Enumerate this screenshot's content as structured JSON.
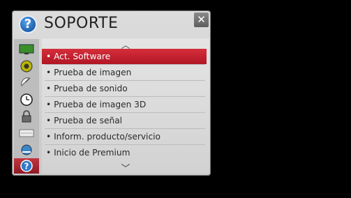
{
  "header": {
    "title": "SOPORTE",
    "help_glyph": "?",
    "close_glyph": "✕"
  },
  "sidebar": [
    {
      "name": "tv-picture-icon",
      "glyph": ""
    },
    {
      "name": "sound-speaker-icon",
      "glyph": ""
    },
    {
      "name": "satellite-dish-icon",
      "glyph": ""
    },
    {
      "name": "clock-icon",
      "glyph": ""
    },
    {
      "name": "lock-icon",
      "glyph": ""
    },
    {
      "name": "keyboard-icon",
      "glyph": ""
    },
    {
      "name": "globe-network-icon",
      "glyph": ""
    },
    {
      "name": "support-question-icon",
      "glyph": "?",
      "active": true
    }
  ],
  "menu": {
    "up_arrow": "︿",
    "down_arrow": "﹀",
    "items": [
      {
        "label": "• Act. Software",
        "selected": true
      },
      {
        "label": "• Prueba de imagen"
      },
      {
        "label": "• Prueba de sonido"
      },
      {
        "label": "• Prueba de imagen 3D"
      },
      {
        "label": "• Prueba de señal"
      },
      {
        "label": "• Inform. producto/servicio"
      },
      {
        "label": "• Inicio de Premium"
      }
    ]
  },
  "colors": {
    "accent": "#c8202d",
    "panel": "#d4d4d4"
  }
}
